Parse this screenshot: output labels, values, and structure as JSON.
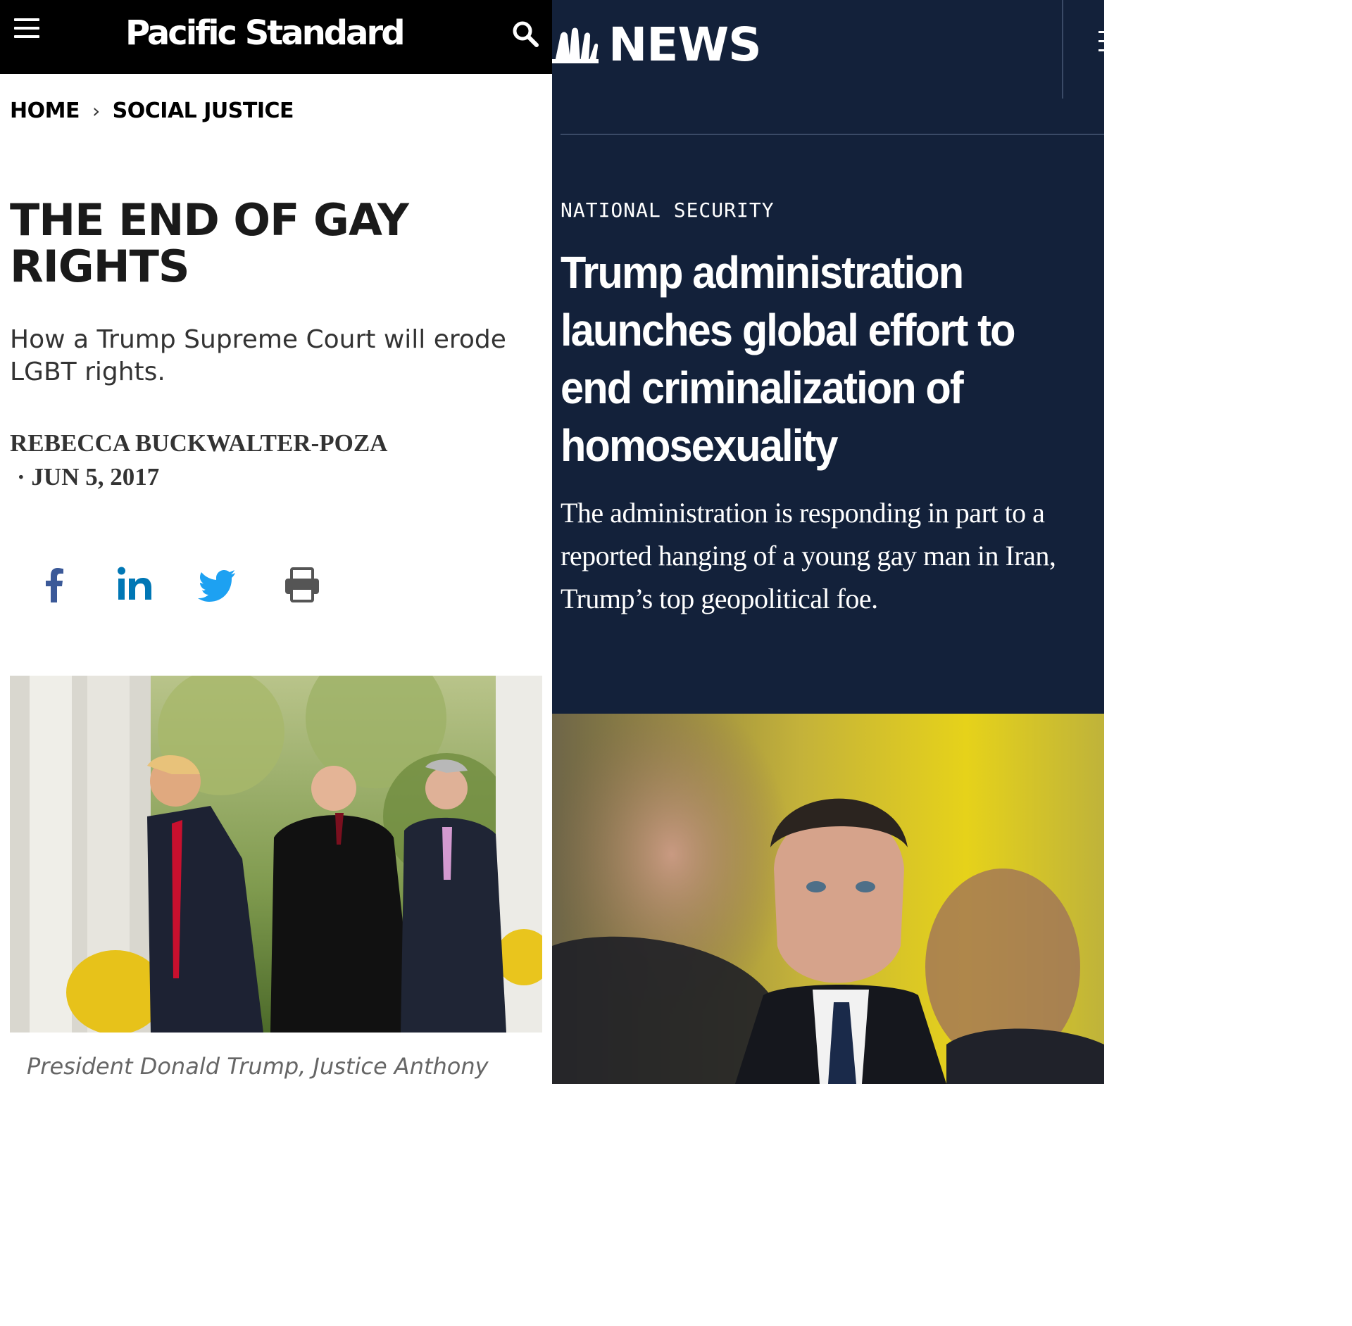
{
  "left": {
    "site_name": "Pacific Standard",
    "breadcrumb": [
      "HOME",
      "SOCIAL JUSTICE"
    ],
    "breadcrumb_separator": "›",
    "title_line1": "THE END OF GAY",
    "title_line2": "RIGHTS",
    "dek": "How a Trump Supreme Court will erode LGBT rights.",
    "author": "REBECCA BUCKWALTER-POZA",
    "date": "· JUN 5, 2017",
    "share_icons": [
      "facebook-icon",
      "linkedin-icon",
      "twitter-icon",
      "print-icon"
    ],
    "caption": "President Donald Trump, Justice Anthony",
    "colors": {
      "header_bg": "#000000",
      "facebook": "#3b5998",
      "linkedin": "#0077b5",
      "twitter": "#1da1f2",
      "print": "#555555"
    }
  },
  "right": {
    "brand": "NEWS",
    "section": "NATIONAL SECURITY",
    "title": "Trump administration launches global effort to end criminalization of homosexuality",
    "dek": "The administration is responding in part to a reported hanging of a young gay man in Iran, Trump’s top geopolitical foe.",
    "colors": {
      "bg": "#13213a"
    }
  }
}
